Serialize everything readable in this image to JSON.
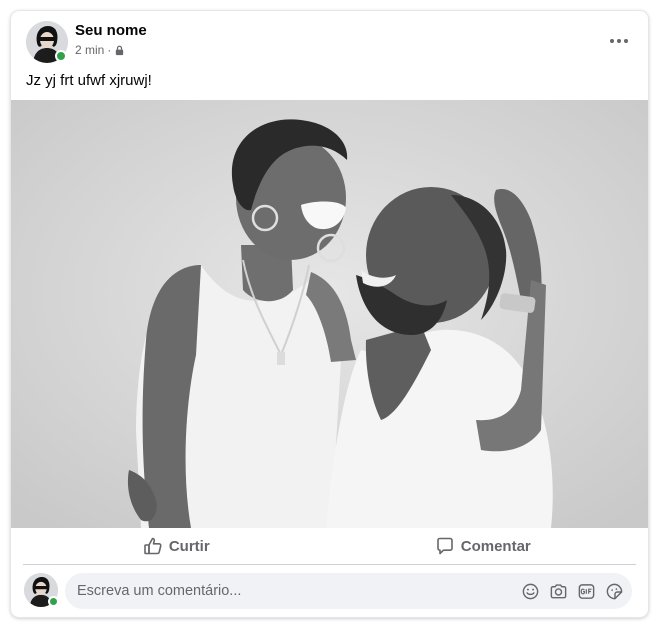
{
  "post": {
    "author_name": "Seu nome",
    "time": "2 min",
    "separator": "·",
    "privacy_icon": "lock-icon",
    "text": "Jz yj frt ufwf xjruwj!",
    "more_icon": "more-options-icon"
  },
  "actions": {
    "like_label": "Curtir",
    "like_icon": "thumbs-up-icon",
    "comment_label": "Comentar",
    "comment_icon": "comment-bubble-icon"
  },
  "comment_box": {
    "placeholder": "Escreva um comentário...",
    "icons": [
      "emoji-icon",
      "camera-icon",
      "gif-icon",
      "sticker-icon"
    ]
  },
  "colors": {
    "online": "#31a24c",
    "secondary_text": "#65676b",
    "input_bg": "#f0f2f5"
  }
}
